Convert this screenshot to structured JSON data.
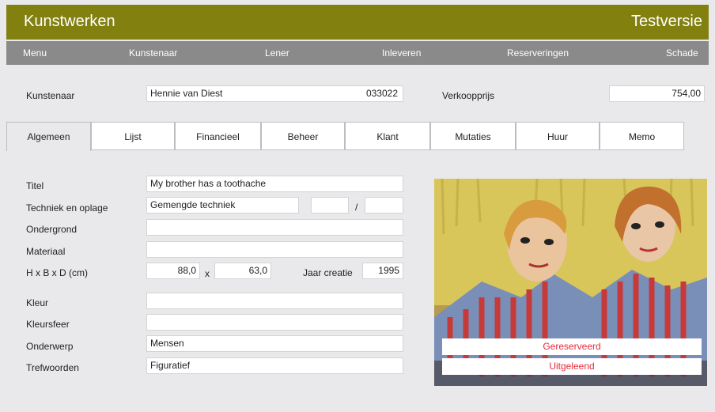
{
  "header": {
    "app_title": "Kunstwerken",
    "version": "Testversie"
  },
  "menu": [
    "Menu",
    "Kunstenaar",
    "Lener",
    "Inleveren",
    "Reserveringen",
    "Schade"
  ],
  "top": {
    "artist_label": "Kunstenaar",
    "artist_name": "Hennie van Diest",
    "artist_code": "033022",
    "price_label": "Verkoopprijs",
    "price_value": "754,00"
  },
  "tabs": [
    "Algemeen",
    "Lijst",
    "Financieel",
    "Beheer",
    "Klant",
    "Mutaties",
    "Huur",
    "Memo"
  ],
  "form": {
    "titel_label": "Titel",
    "titel_value": "My brother has a toothache",
    "techniek_label": "Techniek en oplage",
    "techniek_value": "Gemengde techniek",
    "oplage_value": "",
    "oplage_sep": "/",
    "oplage_total": "",
    "ondergrond_label": "Ondergrond",
    "ondergrond_value": "",
    "materiaal_label": "Materiaal",
    "materiaal_value": "",
    "dim_label": "H x B x D  (cm)",
    "h_value": "88,0",
    "x_sep": "x",
    "b_value": "63,0",
    "jaar_label": "Jaar creatie",
    "jaar_value": "1995",
    "kleur_label": "Kleur",
    "kleur_value": "",
    "kleursfeer_label": "Kleursfeer",
    "kleursfeer_value": "",
    "onderwerp_label": "Onderwerp",
    "onderwerp_value": "Mensen",
    "trefwoorden_label": "Trefwoorden",
    "trefwoorden_value": "Figuratief"
  },
  "status": {
    "reserved": "Gereserveerd",
    "lent": "Uitgeleend"
  },
  "colors": {
    "title_bar": "#82800f",
    "menu_bar": "#8a8a8a",
    "status_text": "#e32b3b"
  }
}
